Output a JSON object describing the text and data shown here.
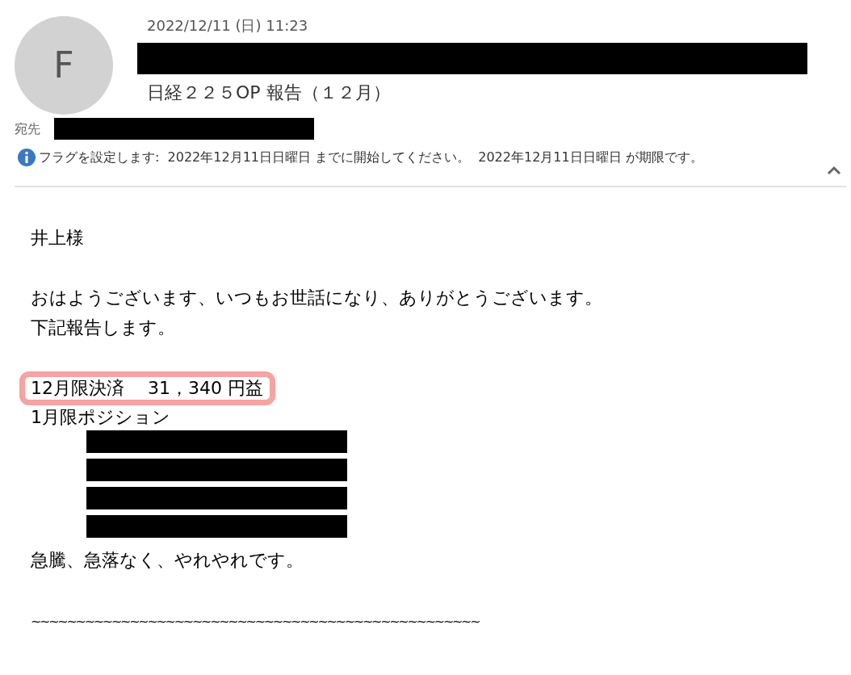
{
  "header": {
    "avatar_initial": "F",
    "date": "2022/12/11 (日) 11:23",
    "sender": {
      "kind": "redacted"
    },
    "subject": "日経２２５OP  報告（１２月）",
    "to_label": "宛先",
    "to": {
      "kind": "redacted"
    },
    "flag_notice": "フラグを設定します:  2022年12月11日日曜日 までに開始してください。  2022年12月11日日曜日 が期限です。",
    "expanded": true
  },
  "body": [
    {
      "kind": "text",
      "text": "井上様"
    },
    {
      "kind": "blank"
    },
    {
      "kind": "text",
      "text": "おはようございます、いつもお世話になり、ありがとうございます。"
    },
    {
      "kind": "text",
      "text": "下記報告します。"
    },
    {
      "kind": "blank"
    },
    {
      "kind": "text",
      "text": "12月限決済　 31，340  円益",
      "highlighted": true
    },
    {
      "kind": "text",
      "text": "1月限ポジション"
    },
    {
      "kind": "redacted"
    },
    {
      "kind": "redacted"
    },
    {
      "kind": "redacted"
    },
    {
      "kind": "redacted"
    },
    {
      "kind": "text",
      "text": "急騰、急落なく、やれやれです。"
    },
    {
      "kind": "blank"
    },
    {
      "kind": "rule",
      "text": "~~~~~~~~~~~~~~~~~~~~~~~~~~~~~~~~~~~~~~~~~~~~~~~~~~"
    }
  ]
}
